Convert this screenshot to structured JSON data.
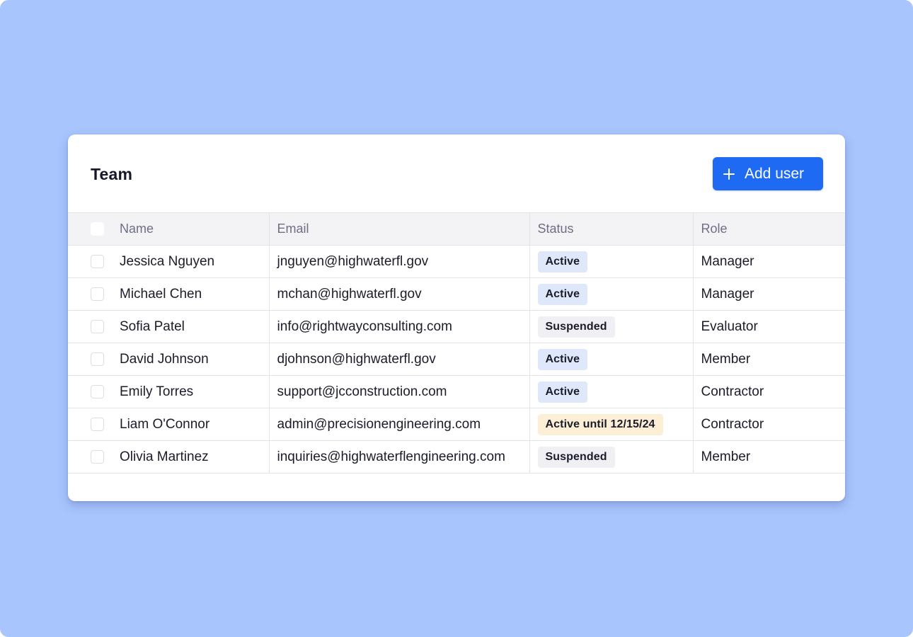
{
  "card": {
    "title": "Team",
    "add_button_label": "Add user"
  },
  "table": {
    "columns": [
      "Name",
      "Email",
      "Status",
      "Role"
    ],
    "rows": [
      {
        "name": "Jessica Nguyen",
        "email": "jnguyen@highwaterfl.gov",
        "status": "Active",
        "status_type": "active",
        "role": "Manager"
      },
      {
        "name": "Michael Chen",
        "email": "mchan@highwaterfl.gov",
        "status": "Active",
        "status_type": "active",
        "role": "Manager"
      },
      {
        "name": "Sofia Patel",
        "email": "info@rightwayconsulting.com",
        "status": "Suspended",
        "status_type": "suspended",
        "role": "Evaluator"
      },
      {
        "name": "David Johnson",
        "email": "djohnson@highwaterfl.gov",
        "status": "Active",
        "status_type": "active",
        "role": "Member"
      },
      {
        "name": "Emily Torres",
        "email": "support@jcconstruction.com",
        "status": "Active",
        "status_type": "active",
        "role": "Contractor"
      },
      {
        "name": "Liam O'Connor",
        "email": "admin@precisionengineering.com",
        "status": "Active until 12/15/24",
        "status_type": "temp",
        "role": "Contractor"
      },
      {
        "name": "Olivia Martinez",
        "email": "inquiries@highwaterflengineering.com",
        "status": "Suspended",
        "status_type": "suspended",
        "role": "Member"
      }
    ]
  },
  "colors": {
    "background": "#a8c5fe",
    "accent": "#1e6af2",
    "badge_active": "#dfe8fb",
    "badge_suspended": "#f0eff3",
    "badge_temp": "#fdefd6"
  },
  "icons": {
    "add_button_icon": "plus-icon"
  }
}
